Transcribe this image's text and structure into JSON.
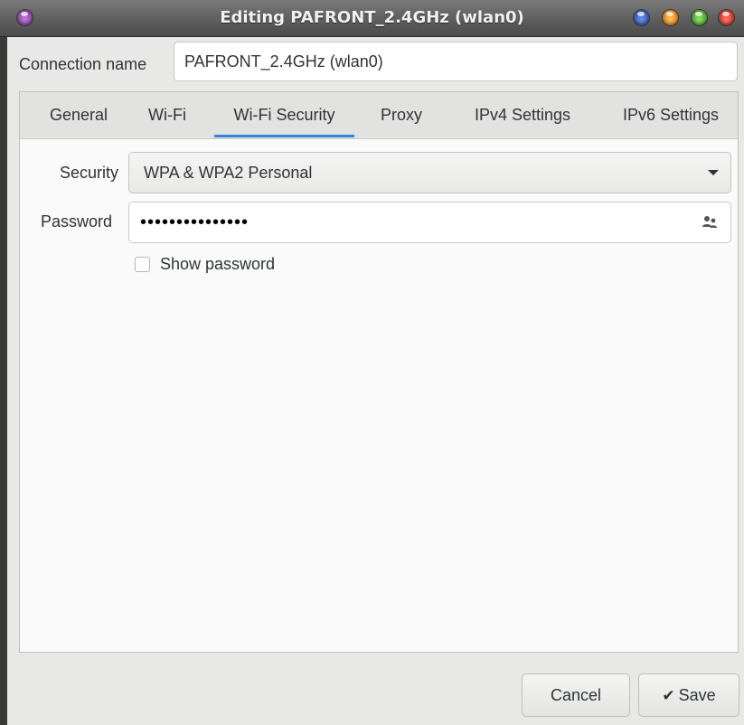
{
  "window": {
    "title": "Editing PAFRONT_2.4GHz (wlan0)"
  },
  "connection": {
    "label": "Connection name",
    "value": "PAFRONT_2.4GHz (wlan0)"
  },
  "tabs": [
    {
      "label": "General"
    },
    {
      "label": "Wi-Fi"
    },
    {
      "label": "Wi-Fi Security",
      "active": true
    },
    {
      "label": "Proxy"
    },
    {
      "label": "IPv4 Settings"
    },
    {
      "label": "IPv6 Settings"
    }
  ],
  "security": {
    "label": "Security",
    "selected": "WPA & WPA2 Personal"
  },
  "password": {
    "label": "Password",
    "masked_value": "•••••••••••••••",
    "icon": "users-icon"
  },
  "show_password": {
    "label": "Show password",
    "checked": false
  },
  "buttons": {
    "cancel": "Cancel",
    "save": "Save",
    "save_icon": "checkmark-icon"
  },
  "colors": {
    "accent": "#3584e4",
    "titlebar": "#5e5e5e"
  }
}
